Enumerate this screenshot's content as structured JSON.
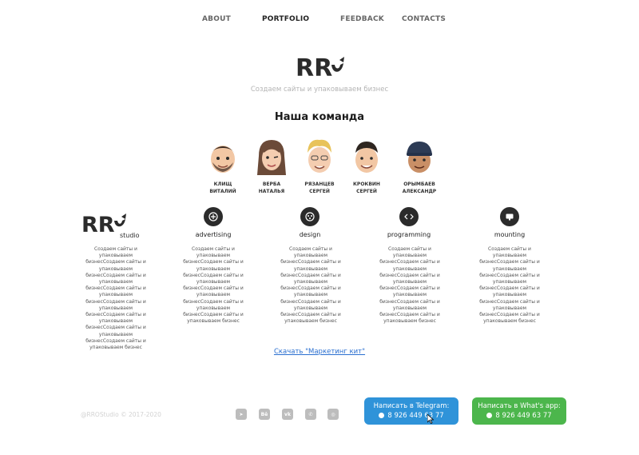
{
  "nav": {
    "items": [
      {
        "label": "ABOUT",
        "active": false
      },
      {
        "label": "PORTFOLIO",
        "active": true
      },
      {
        "label": "FEEDBACK",
        "active": false
      },
      {
        "label": "CONTACTS",
        "active": false
      }
    ]
  },
  "header": {
    "tagline": "Создаем сайты и упаковываем бизнес"
  },
  "team": {
    "title": "Наша команда",
    "members": [
      {
        "last": "КЛИЩ",
        "first": "ВИТАЛИЙ"
      },
      {
        "last": "ВЕРБА",
        "first": "НАТАЛЬЯ"
      },
      {
        "last": "РЯЗАНЦЕВ",
        "first": "СЕРГЕЙ"
      },
      {
        "last": "КРОКВИН",
        "first": "СЕРГЕЙ"
      },
      {
        "last": "ОРЫМБАЕВ",
        "first": "АЛЕКСАНДР"
      }
    ]
  },
  "studio": {
    "logo_word": "studio",
    "description": "Создаем сайты и упаковываем бизнесСоздаем сайты и упаковываем бизнесСоздаем сайты и упаковываем бизнесСоздаем сайты и упаковываем бизнесСоздаем сайты и упаковываем бизнесСоздаем сайты и упаковываем бизнесСоздаем сайты и упаковываем бизнесСоздаем сайты и упаковываем бизнес"
  },
  "services": [
    {
      "title": "advertising",
      "icon": "advertising-icon",
      "description": "Создаем сайты и упаковываем бизнесСоздаем сайты и упаковываем бизнесСоздаем сайты и упаковываем бизнесСоздаем сайты и упаковываем бизнесСоздаем сайты и упаковываем бизнесСоздаем сайты и упаковываем бизнес"
    },
    {
      "title": "design",
      "icon": "design-icon",
      "description": "Создаем сайты и упаковываем бизнесСоздаем сайты и упаковываем бизнесСоздаем сайты и упаковываем бизнесСоздаем сайты и упаковываем бизнесСоздаем сайты и упаковываем бизнесСоздаем сайты и упаковываем бизнес"
    },
    {
      "title": "programming",
      "icon": "code-icon",
      "description": "Создаем сайты и упаковываем бизнесСоздаем сайты и упаковываем бизнесСоздаем сайты и упаковываем бизнесСоздаем сайты и упаковываем бизнесСоздаем сайты и упаковываем бизнесСоздаем сайты и упаковываем бизнес"
    },
    {
      "title": "mounting",
      "icon": "mounting-icon",
      "description": "Создаем сайты и упаковываем бизнесСоздаем сайты и упаковываем бизнесСоздаем сайты и упаковываем бизнесСоздаем сайты и упаковываем бизнесСоздаем сайты и упаковываем бизнесСоздаем сайты и упаковываем бизнес"
    }
  ],
  "kit_link": "Скачать \"Маркетинг кит\"",
  "footer": {
    "copyright": "@RROStudio © 2017-2020",
    "socials": [
      {
        "icon": "telegram-icon",
        "glyph": "➤"
      },
      {
        "icon": "behance-icon",
        "glyph": "Bē"
      },
      {
        "icon": "vk-icon",
        "glyph": "vk"
      },
      {
        "icon": "whatsapp-icon",
        "glyph": "✆"
      },
      {
        "icon": "instagram-icon",
        "glyph": "◎"
      }
    ],
    "telegram_button": {
      "label": "Написать в Telegram:",
      "phone": "8 926 449 63 77",
      "color": "#2f93d9"
    },
    "whatsapp_button": {
      "label": "Написать в What's app:",
      "phone": "8 926 449 63 77",
      "color": "#4cb64c"
    }
  }
}
